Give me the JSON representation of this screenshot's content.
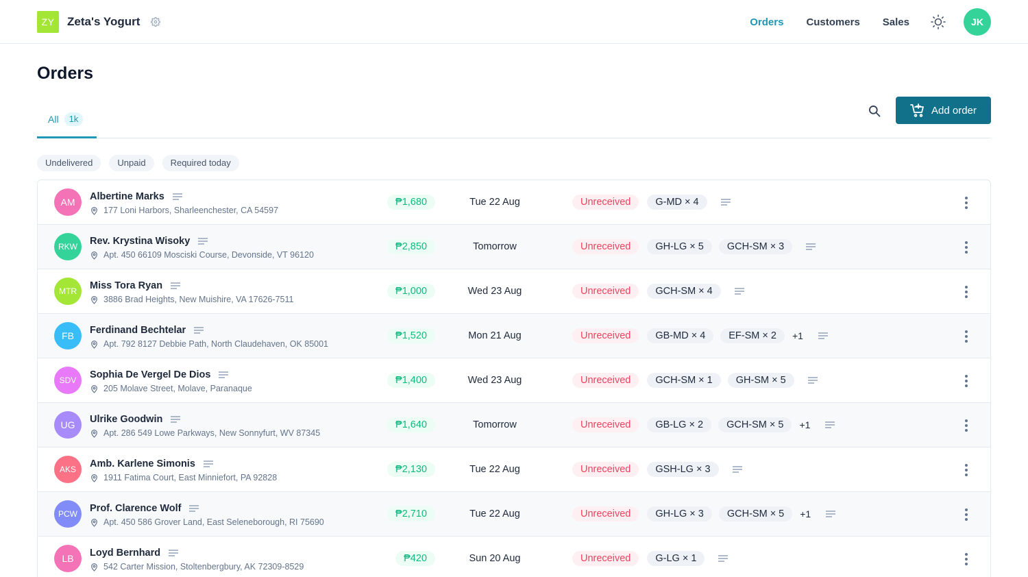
{
  "app": {
    "logo_initials": "ZY",
    "logo_color": "#a3e635",
    "name": "Zeta's Yogurt",
    "settings_icon": "gear-icon"
  },
  "nav": {
    "items": [
      {
        "label": "Orders",
        "active": true
      },
      {
        "label": "Customers",
        "active": false
      },
      {
        "label": "Sales",
        "active": false
      }
    ],
    "theme_icon": "sun-icon",
    "user_initials": "JK",
    "user_color": "#34d399"
  },
  "page": {
    "title": "Orders",
    "tabs": [
      {
        "label": "All",
        "count": "1k",
        "active": true
      }
    ],
    "search_icon": "search-icon",
    "add_button_label": "Add order",
    "filters": [
      "Undelivered",
      "Unpaid",
      "Required today"
    ]
  },
  "colors": {
    "accent": "#1f97b5",
    "primary_button": "#11708a",
    "amount_text": "#10b981",
    "status_text": "#f43f5e"
  },
  "orders": [
    {
      "initials": "AM",
      "color": "#f472b6",
      "name": "Albertine Marks",
      "address": "177 Loni Harbors, Sharleenchester, CA 54597",
      "amount": "₱1,680",
      "date": "Tue 22 Aug",
      "status": "Unreceived",
      "items": [
        "G-MD × 4"
      ],
      "more": ""
    },
    {
      "initials": "RKW",
      "color": "#34d399",
      "name": "Rev. Krystina Wisoky",
      "address": "Apt. 450 66109 Mosciski Course, Devonside, VT 96120",
      "amount": "₱2,850",
      "date": "Tomorrow",
      "status": "Unreceived",
      "items": [
        "GH-LG × 5",
        "GCH-SM × 3"
      ],
      "more": ""
    },
    {
      "initials": "MTR",
      "color": "#a3e635",
      "name": "Miss Tora Ryan",
      "address": "3886 Brad Heights, New Muishire, VA 17626-7511",
      "amount": "₱1,000",
      "date": "Wed 23 Aug",
      "status": "Unreceived",
      "items": [
        "GCH-SM × 4"
      ],
      "more": ""
    },
    {
      "initials": "FB",
      "color": "#38bdf8",
      "name": "Ferdinand Bechtelar",
      "address": "Apt. 792 8127 Debbie Path, North Claudehaven, OK 85001",
      "amount": "₱1,520",
      "date": "Mon 21 Aug",
      "status": "Unreceived",
      "items": [
        "GB-MD × 4",
        "EF-SM × 2"
      ],
      "more": "+1"
    },
    {
      "initials": "SDV",
      "color": "#e879f9",
      "name": "Sophia De Vergel De Dios",
      "address": "205 Molave Street, Molave, Paranaque",
      "amount": "₱1,400",
      "date": "Wed 23 Aug",
      "status": "Unreceived",
      "items": [
        "GCH-SM × 1",
        "GH-SM × 5"
      ],
      "more": ""
    },
    {
      "initials": "UG",
      "color": "#a78bfa",
      "name": "Ulrike Goodwin",
      "address": "Apt. 286 549 Lowe Parkways, New Sonnyfurt, WV 87345",
      "amount": "₱1,640",
      "date": "Tomorrow",
      "status": "Unreceived",
      "items": [
        "GB-LG × 2",
        "GCH-SM × 5"
      ],
      "more": "+1"
    },
    {
      "initials": "AKS",
      "color": "#fb7185",
      "name": "Amb. Karlene Simonis",
      "address": "1911 Fatima Court, East Minniefort, PA 92828",
      "amount": "₱2,130",
      "date": "Tue 22 Aug",
      "status": "Unreceived",
      "items": [
        "GSH-LG × 3"
      ],
      "more": ""
    },
    {
      "initials": "PCW",
      "color": "#818cf8",
      "name": "Prof. Clarence Wolf",
      "address": "Apt. 450 586 Grover Land, East Seleneborough, RI 75690",
      "amount": "₱2,710",
      "date": "Tue 22 Aug",
      "status": "Unreceived",
      "items": [
        "GH-LG × 3",
        "GCH-SM × 5"
      ],
      "more": "+1"
    },
    {
      "initials": "LB",
      "color": "#f472b6",
      "name": "Loyd Bernhard",
      "address": "542 Carter Mission, Stoltenbergbury, AK 72309-8529",
      "amount": "₱420",
      "date": "Sun 20 Aug",
      "status": "Unreceived",
      "items": [
        "G-LG × 1"
      ],
      "more": ""
    }
  ]
}
